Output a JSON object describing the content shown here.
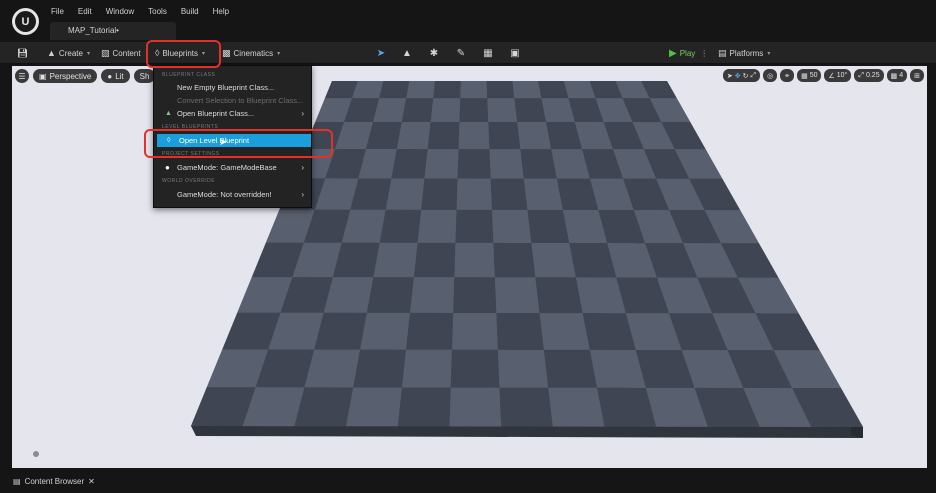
{
  "menu": [
    "File",
    "Edit",
    "Window",
    "Tools",
    "Build",
    "Help"
  ],
  "tab": {
    "title": "MAP_Tutorial•"
  },
  "toolbar": {
    "create": "Create",
    "content": "Content",
    "blueprints": "Blueprints",
    "cinematics": "Cinematics",
    "play": "Play",
    "platforms": "Platforms"
  },
  "viewport": {
    "perspective": "Perspective",
    "lit": "Lit",
    "show": "Sh",
    "grid_snap": "50",
    "angle_snap": "10°",
    "scale_snap": "0.25",
    "camera_speed": "4"
  },
  "dropdown": {
    "section_blueprint_class": "BLUEPRINT CLASS",
    "new_empty": "New Empty Blueprint Class...",
    "convert_selection": "Convert Selection to Blueprint Class...",
    "open_class": "Open Blueprint Class...",
    "section_level": "LEVEL BLUEPRINTS",
    "open_level": "Open Level Blueprint",
    "section_project": "PROJECT SETTINGS",
    "gamemode": "GameMode: GameModeBase",
    "section_world": "WORLD OVERRIDE",
    "gamemode_override": "GameMode: Not overridden!"
  },
  "bottom": {
    "content_browser": "Content Browser"
  },
  "colors": {
    "highlight": "#e2312b",
    "selected": "#1a9fdc",
    "viewport_bg": "#e5e5ee"
  }
}
